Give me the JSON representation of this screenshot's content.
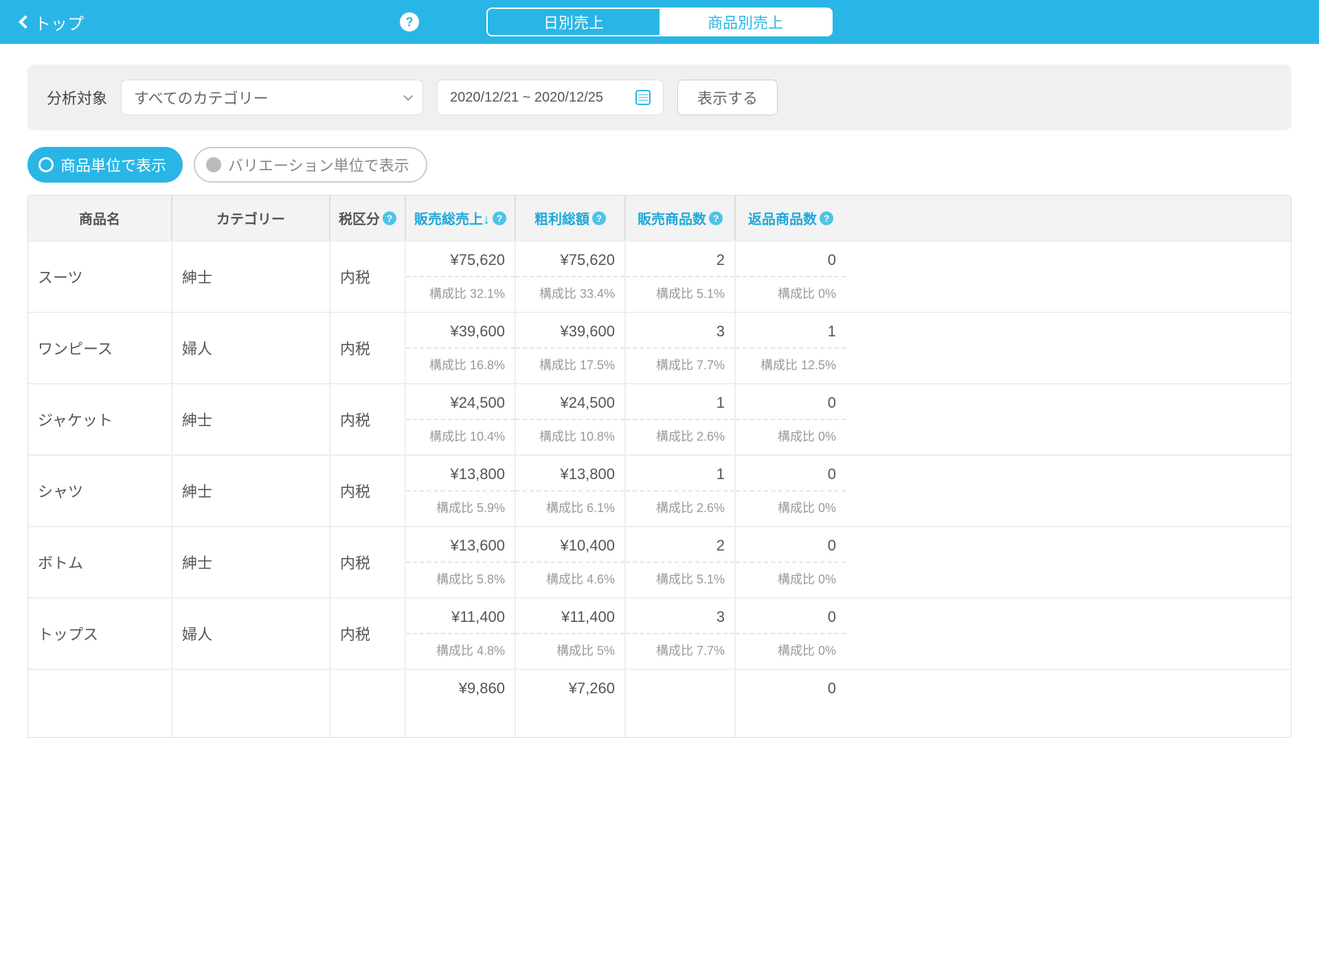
{
  "header": {
    "back_label": "トップ",
    "tabs": {
      "daily": "日別売上",
      "product": "商品別売上"
    }
  },
  "filter": {
    "label": "分析対象",
    "category_selected": "すべてのカテゴリー",
    "date_range": "2020/12/21 ~ 2020/12/25",
    "show_button": "表示する"
  },
  "view_toggle": {
    "by_product": "商品単位で表示",
    "by_variation": "バリエーション単位で表示"
  },
  "ratio_label": "構成比",
  "columns": {
    "name": "商品名",
    "category": "カテゴリー",
    "tax": "税区分",
    "total_sales": "販売総売上↓",
    "gross_profit": "粗利総額",
    "sold_qty": "販売商品数",
    "return_qty": "返品商品数"
  },
  "rows": [
    {
      "name": "スーツ",
      "category": "紳士",
      "tax": "内税",
      "total_sales": "¥75,620",
      "total_sales_ratio": "32.1%",
      "gross_profit": "¥75,620",
      "gross_profit_ratio": "33.4%",
      "sold_qty": "2",
      "sold_qty_ratio": "5.1%",
      "return_qty": "0",
      "return_qty_ratio": "0%"
    },
    {
      "name": "ワンピース",
      "category": "婦人",
      "tax": "内税",
      "total_sales": "¥39,600",
      "total_sales_ratio": "16.8%",
      "gross_profit": "¥39,600",
      "gross_profit_ratio": "17.5%",
      "sold_qty": "3",
      "sold_qty_ratio": "7.7%",
      "return_qty": "1",
      "return_qty_ratio": "12.5%"
    },
    {
      "name": "ジャケット",
      "category": "紳士",
      "tax": "内税",
      "total_sales": "¥24,500",
      "total_sales_ratio": "10.4%",
      "gross_profit": "¥24,500",
      "gross_profit_ratio": "10.8%",
      "sold_qty": "1",
      "sold_qty_ratio": "2.6%",
      "return_qty": "0",
      "return_qty_ratio": "0%"
    },
    {
      "name": "シャツ",
      "category": "紳士",
      "tax": "内税",
      "total_sales": "¥13,800",
      "total_sales_ratio": "5.9%",
      "gross_profit": "¥13,800",
      "gross_profit_ratio": "6.1%",
      "sold_qty": "1",
      "sold_qty_ratio": "2.6%",
      "return_qty": "0",
      "return_qty_ratio": "0%"
    },
    {
      "name": "ボトム",
      "category": "紳士",
      "tax": "内税",
      "total_sales": "¥13,600",
      "total_sales_ratio": "5.8%",
      "gross_profit": "¥10,400",
      "gross_profit_ratio": "4.6%",
      "sold_qty": "2",
      "sold_qty_ratio": "5.1%",
      "return_qty": "0",
      "return_qty_ratio": "0%"
    },
    {
      "name": "トップス",
      "category": "婦人",
      "tax": "内税",
      "total_sales": "¥11,400",
      "total_sales_ratio": "4.8%",
      "gross_profit": "¥11,400",
      "gross_profit_ratio": "5%",
      "sold_qty": "3",
      "sold_qty_ratio": "7.7%",
      "return_qty": "0",
      "return_qty_ratio": "0%"
    },
    {
      "name": "",
      "category": "",
      "tax": "",
      "total_sales": "¥9,860",
      "total_sales_ratio": "",
      "gross_profit": "¥7,260",
      "gross_profit_ratio": "",
      "sold_qty": "",
      "sold_qty_ratio": "",
      "return_qty": "0",
      "return_qty_ratio": ""
    }
  ]
}
